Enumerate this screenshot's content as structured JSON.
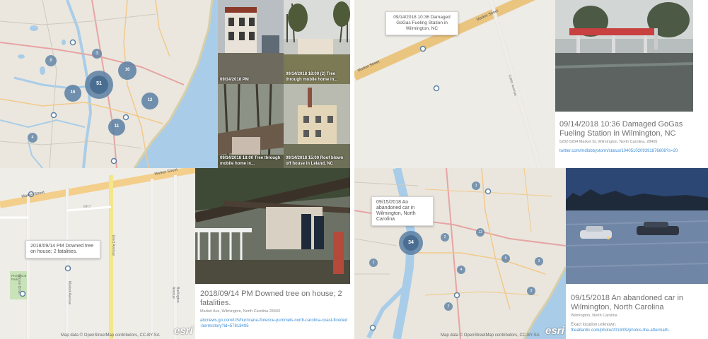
{
  "panel_tl": {
    "clusters": [
      {
        "label": "51",
        "size": "large"
      },
      {
        "label": "16",
        "size": "medium"
      },
      {
        "label": "16",
        "size": "medium"
      },
      {
        "label": "12",
        "size": "medium"
      },
      {
        "label": "11",
        "size": "medium"
      },
      {
        "label": "8",
        "size": "small"
      },
      {
        "label": "3",
        "size": "small"
      },
      {
        "label": "4",
        "size": "small"
      }
    ],
    "photos": [
      {
        "caption": "09/14/2018 PM"
      },
      {
        "caption": "09/14/2018 18:00 (2) Tree through mobile home in..."
      },
      {
        "caption": "09/14/2018 18:00 Tree through mobile home in..."
      },
      {
        "caption": "09/14/2018 15:00 Roof blown off house in Leland, NC"
      }
    ]
  },
  "panel_tr": {
    "road_label": "Market Street",
    "road_label_2": "Market Street",
    "popup": "09/14/2018 10:36 Damaged GoGas Fueling Station in Wilmington, NC",
    "side_road": "Cutler Avenue",
    "title": "09/14/2018 10:36 Damaged GoGas Fueling Station in Wilmington, NC",
    "address": "5202-5204 Market St, Wilmington, North Carolina, 28405",
    "link": "twitter.com/mdlobbystorm/status/1040510209391876608?s=20"
  },
  "panel_bl": {
    "road_label": "Market Street",
    "road_label_2": "Market Street",
    "map_letter": "MKT",
    "popup": "2018/09/14 PM Downed tree on house; 2 fatalities.",
    "street_1": "Wayne Drive",
    "street_2": "Market Avenue",
    "street_3": "Elect Avenue",
    "street_4": "Burlington Avenue",
    "park": "Riverwood Park",
    "attribution": "Map data © OpenStreetMap contributors, CC-BY-SA",
    "esri": "esri",
    "title": "2018/09/14 PM Downed tree on house; 2 fatalities.",
    "address": "Market Ave, Wilmington, North Carolina 28403",
    "link": "abcnews.go.com/US/hurricane-florence-pummels-north-carolina-coast-flooded-berm/story?id=57818495"
  },
  "panel_br": {
    "clusters": [
      {
        "label": "34",
        "size": "large"
      },
      {
        "label": "3",
        "size": "small"
      },
      {
        "label": "13",
        "size": "small"
      },
      {
        "label": "2",
        "size": "small"
      },
      {
        "label": "4",
        "size": "small"
      },
      {
        "label": "5",
        "size": "small"
      },
      {
        "label": "3",
        "size": "small"
      },
      {
        "label": "2",
        "size": "small"
      },
      {
        "label": "2",
        "size": "small"
      },
      {
        "label": "3",
        "size": "small"
      }
    ],
    "popup": "09/15/2018 An abandoned car in Wilmington, North Carolina",
    "attribution": "Map data © OpenStreetMap contributors, CC-BY-SA",
    "esri": "esri",
    "title": "09/15/2018 An abandoned car in Wilmington, North Carolina",
    "address": "Wilmington, North Carolina",
    "note": "Exact location unknown.",
    "link": "theatlantic.com/photo/2018/09/photos-the-aftermath-"
  },
  "colors": {
    "cluster": "#5b7fa3",
    "water": "#a9cde8",
    "land": "#eae6dd",
    "link": "#3b8ed8"
  }
}
